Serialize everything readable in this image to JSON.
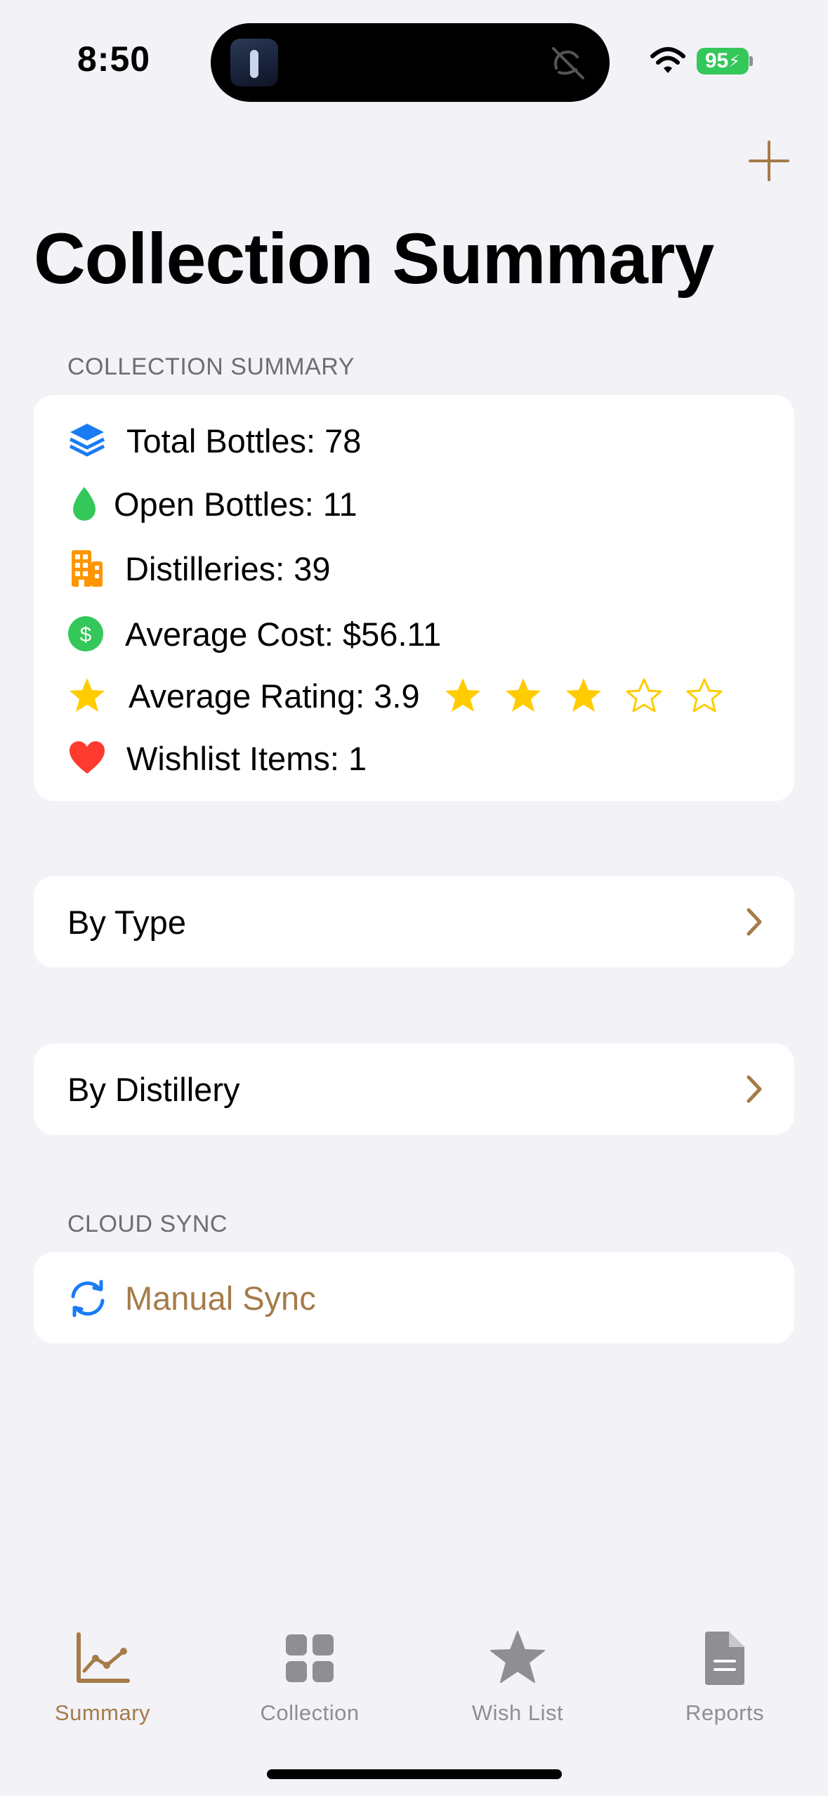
{
  "status_bar": {
    "time": "8:50",
    "battery": "95"
  },
  "header": {
    "title": "Collection Summary",
    "add_icon": "plus-icon"
  },
  "summary_section": {
    "header": "COLLECTION SUMMARY",
    "rows": [
      {
        "icon": "stack-icon",
        "text": "Total Bottles: 78"
      },
      {
        "icon": "drop-icon",
        "text": "Open Bottles: 11"
      },
      {
        "icon": "building-icon",
        "text": "Distilleries: 39"
      },
      {
        "icon": "dollar-icon",
        "text": "Average Cost: $56.11"
      },
      {
        "icon": "star-icon",
        "text": "Average Rating: 3.9"
      },
      {
        "icon": "heart-icon",
        "text": "Wishlist Items: 1"
      }
    ],
    "rating_stars_filled": 3,
    "rating_stars_total": 5
  },
  "nav_items": [
    {
      "label": "By Type",
      "icon": "chevron-right-icon"
    },
    {
      "label": "By Distillery",
      "icon": "chevron-right-icon"
    }
  ],
  "cloud_section": {
    "header": "CLOUD SYNC",
    "sync_label": "Manual Sync",
    "icon": "sync-icon"
  },
  "tab_bar": {
    "tabs": [
      {
        "label": "Summary",
        "icon": "chart-icon",
        "selected": true
      },
      {
        "label": "Collection",
        "icon": "grid-icon",
        "selected": false
      },
      {
        "label": "Wish List",
        "icon": "star-icon",
        "selected": false
      },
      {
        "label": "Reports",
        "icon": "document-icon",
        "selected": false
      }
    ]
  },
  "colors": {
    "accent": "#a57b49",
    "background": "#f2f2f7",
    "inactive": "#8e8e93",
    "blue": "#1a7cf5",
    "green": "#34c759",
    "orange": "#ff9500",
    "yellow": "#ffcc00",
    "red": "#ff3b30"
  }
}
